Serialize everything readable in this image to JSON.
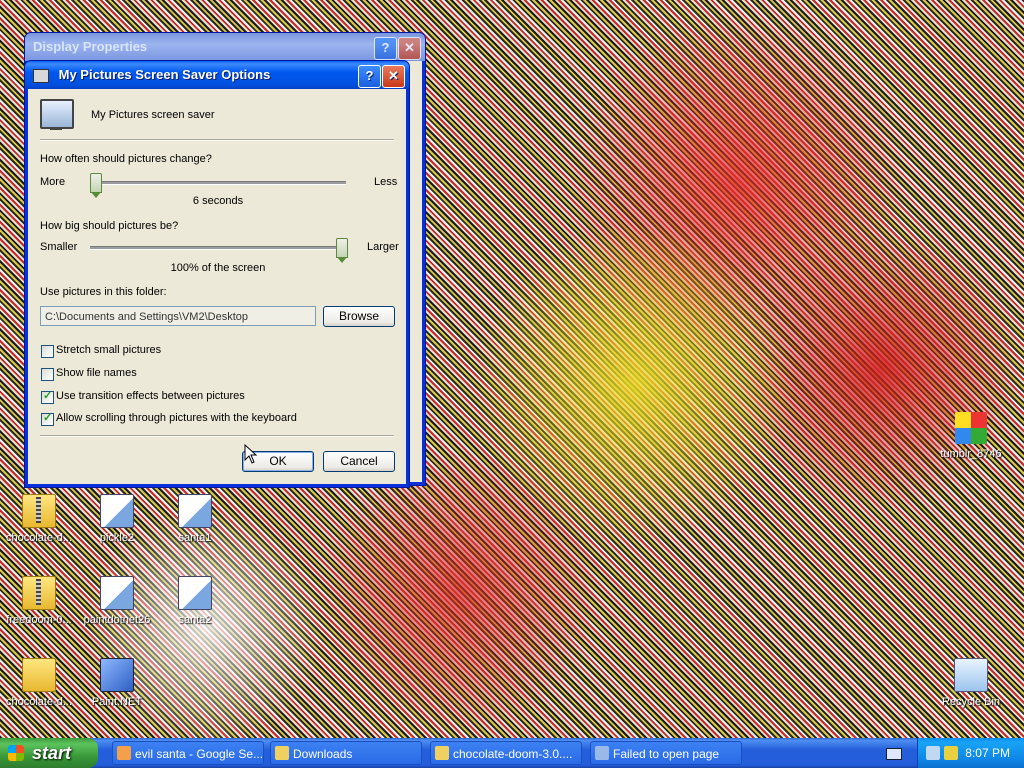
{
  "desktop": {
    "icons": [
      {
        "label": "chocolate-d...",
        "icon": "zip-folder-icon"
      },
      {
        "label": "pickle2",
        "icon": "paint-file-icon"
      },
      {
        "label": "santa1",
        "icon": "paint-file-icon"
      },
      {
        "label": "freedoom-0...",
        "icon": "zip-folder-icon"
      },
      {
        "label": "paintdotnet26",
        "icon": "paint-file-icon"
      },
      {
        "label": "santa2",
        "icon": "paint-file-icon"
      },
      {
        "label": "chocolate-d...",
        "icon": "folder-icon"
      },
      {
        "label": "Paint.NET",
        "icon": "paintnet-icon"
      },
      {
        "label": "tumblr_8746",
        "icon": "image-file-icon"
      },
      {
        "label": "Recycle Bin",
        "icon": "recycle-bin-icon"
      }
    ]
  },
  "display_properties": {
    "title": "Display Properties",
    "help": "?",
    "close": "✕"
  },
  "dialog": {
    "title": "My Pictures Screen Saver Options",
    "help": "?",
    "close": "✕",
    "header_label": "My Pictures screen saver",
    "change": {
      "question": "How often should pictures change?",
      "left": "More",
      "right": "Less",
      "value_text": "6 seconds",
      "slider_fraction": 0.0
    },
    "size": {
      "question": "How big should pictures be?",
      "left": "Smaller",
      "right": "Larger",
      "value_text": "100% of the screen",
      "slider_fraction": 1.0
    },
    "folder": {
      "label": "Use pictures in this folder:",
      "path": "C:\\Documents and Settings\\VM2\\Desktop",
      "browse": "Browse"
    },
    "options": [
      {
        "label": "Stretch small pictures",
        "checked": false
      },
      {
        "label": "Show file names",
        "checked": false
      },
      {
        "label": "Use transition effects between pictures",
        "checked": true
      },
      {
        "label": "Allow scrolling through pictures with the keyboard",
        "checked": true
      }
    ],
    "ok": "OK",
    "cancel": "Cancel"
  },
  "taskbar": {
    "start": "start",
    "tasks": [
      {
        "label": "evil santa - Google Se...",
        "icon": "browser-icon"
      },
      {
        "label": "Downloads",
        "icon": "folder-icon"
      },
      {
        "label": "chocolate-doom-3.0....",
        "icon": "folder-icon"
      },
      {
        "label": "Failed to open page",
        "icon": "browser-icon"
      }
    ],
    "clock": "8:07 PM"
  }
}
